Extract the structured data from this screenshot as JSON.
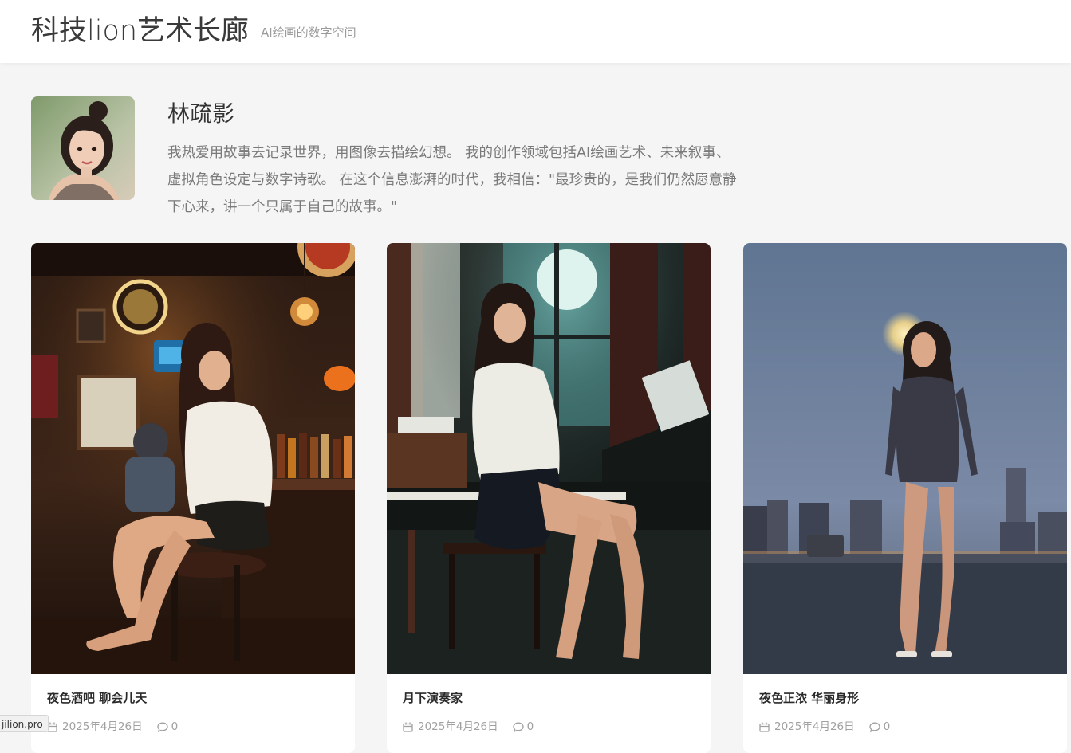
{
  "header": {
    "site_title": "科技lion艺术长廊",
    "tagline": "AI绘画的数字空间"
  },
  "profile": {
    "name": "林疏影",
    "bio": "我热爱用故事去记录世界，用图像去描绘幻想。 我的创作领域包括AI绘画艺术、未来叙事、虚拟角色设定与数字诗歌。 在这个信息澎湃的时代，我相信：\"最珍贵的，是我们仍然愿意静下心来，讲一个只属于自己的故事。\""
  },
  "cards": [
    {
      "title": "夜色酒吧 聊会儿天",
      "date": "2025年4月26日",
      "comments": "0"
    },
    {
      "title": "月下演奏家",
      "date": "2025年4月26日",
      "comments": "0"
    },
    {
      "title": "夜色正浓 华丽身形",
      "date": "2025年4月26日",
      "comments": "0"
    }
  ],
  "status_bar": {
    "url": "jilion.pro"
  },
  "colors": {
    "header_bg": "#ffffff",
    "page_bg": "#f5f5f5",
    "muted_text": "#9a9a9a"
  }
}
